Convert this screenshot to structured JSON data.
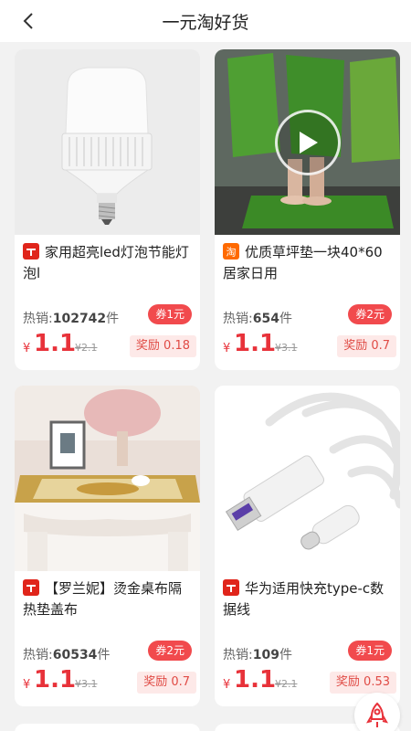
{
  "header": {
    "title": "一元淘好货"
  },
  "products": [
    {
      "title": "家用超亮led灯泡节能灯泡l",
      "platform": "tmall",
      "sales_label": "热销:",
      "sales": "102742",
      "sales_unit": "件",
      "coupon": "券1元",
      "currency": "¥",
      "price": "1.1",
      "original": "¥2.1",
      "reward": "奖励 0.18",
      "has_video": false
    },
    {
      "title": "优质草坪垫一块40*60居家日用",
      "platform": "taobao",
      "sales_label": "热销:",
      "sales": "654",
      "sales_unit": "件",
      "coupon": "券2元",
      "currency": "¥",
      "price": "1.1",
      "original": "¥3.1",
      "reward": "奖励 0.7",
      "has_video": true
    },
    {
      "title": "【罗兰妮】烫金桌布隔热垫盖布",
      "platform": "tmall",
      "sales_label": "热销:",
      "sales": "60534",
      "sales_unit": "件",
      "coupon": "券2元",
      "currency": "¥",
      "price": "1.1",
      "original": "¥3.1",
      "reward": "奖励 0.7",
      "has_video": false
    },
    {
      "title": "华为适用快充type-c数据线",
      "platform": "tmall",
      "sales_label": "热销:",
      "sales": "109",
      "sales_unit": "件",
      "coupon": "券1元",
      "currency": "¥",
      "price": "1.1",
      "original": "¥2.1",
      "reward": "奖励 0.53",
      "has_video": false
    }
  ],
  "colors": {
    "price_red": "#e8323a",
    "coupon_bg": "#f14a4d",
    "reward_bg": "#fde9e8",
    "tmall_red": "#e0251b",
    "taobao_orange": "#ff6a00"
  }
}
